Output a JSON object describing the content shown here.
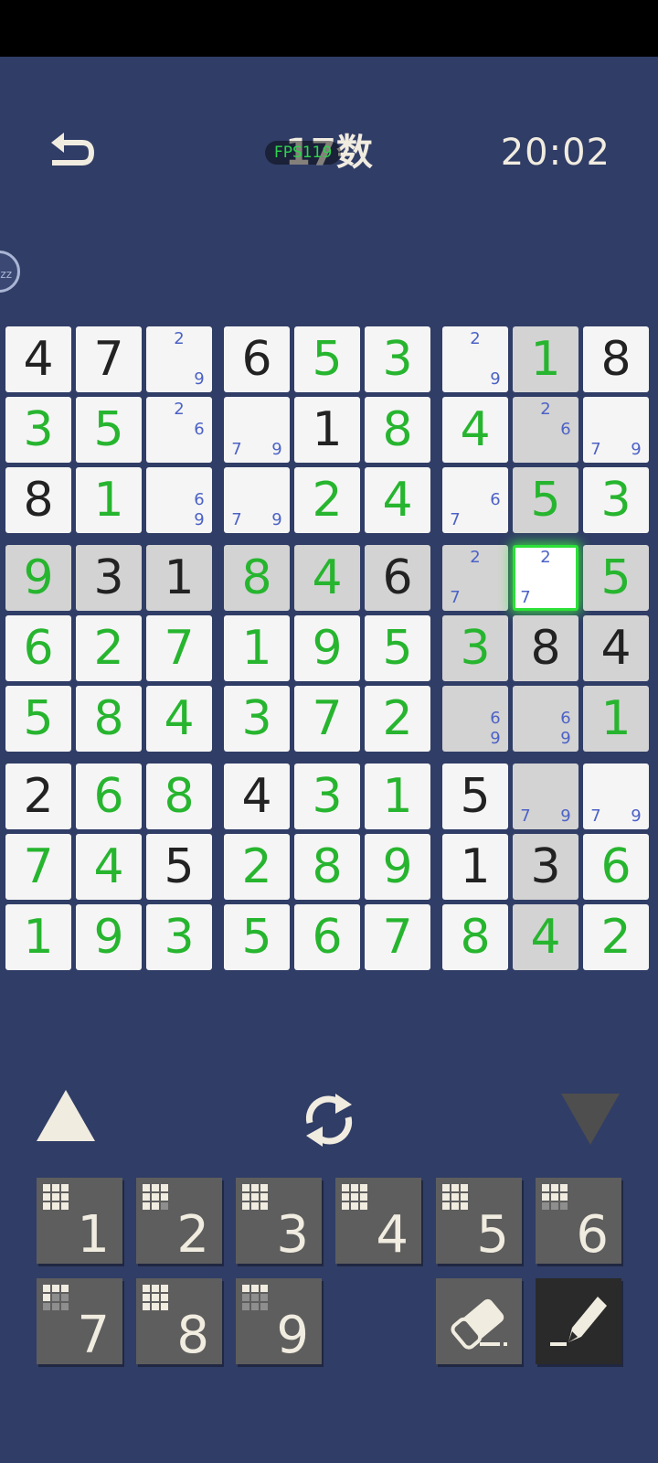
{
  "header": {
    "title": "17数",
    "fps_label": "FPS119",
    "timer": "20:02",
    "side_bubble_label": "zz"
  },
  "colors": {
    "background": "#303d66",
    "cell": "#f5f5f5",
    "highlight": "#d3d3d3",
    "given_digit": "#222222",
    "user_digit": "#27b52f",
    "note_digit": "#4c62c6",
    "selection_glow": "#2be037",
    "key": "#5e5e5e",
    "pencil_key_active": "#2a2a2a"
  },
  "board": {
    "given": [
      [
        1,
        1,
        0,
        1,
        0,
        0,
        0,
        0,
        1
      ],
      [
        0,
        0,
        0,
        0,
        1,
        0,
        0,
        0,
        0
      ],
      [
        1,
        0,
        0,
        0,
        0,
        0,
        0,
        0,
        0
      ],
      [
        0,
        1,
        1,
        0,
        0,
        1,
        0,
        0,
        0
      ],
      [
        0,
        0,
        0,
        0,
        0,
        0,
        0,
        1,
        1
      ],
      [
        0,
        0,
        0,
        0,
        0,
        0,
        0,
        0,
        0
      ],
      [
        1,
        0,
        0,
        1,
        0,
        0,
        1,
        0,
        0
      ],
      [
        0,
        0,
        1,
        0,
        0,
        0,
        1,
        1,
        0
      ],
      [
        0,
        0,
        0,
        0,
        0,
        0,
        0,
        0,
        0
      ]
    ],
    "values": [
      [
        "4",
        "7",
        "",
        "6",
        "5",
        "3",
        "",
        "1",
        "8"
      ],
      [
        "3",
        "5",
        "",
        "",
        "1",
        "8",
        "4",
        "",
        ""
      ],
      [
        "8",
        "1",
        "",
        "",
        "2",
        "4",
        "",
        "5",
        "3"
      ],
      [
        "9",
        "3",
        "1",
        "8",
        "4",
        "6",
        "",
        "",
        "5"
      ],
      [
        "6",
        "2",
        "7",
        "1",
        "9",
        "5",
        "3",
        "8",
        "4"
      ],
      [
        "5",
        "8",
        "4",
        "3",
        "7",
        "2",
        "",
        "",
        "1"
      ],
      [
        "2",
        "6",
        "8",
        "4",
        "3",
        "1",
        "5",
        "",
        ""
      ],
      [
        "7",
        "4",
        "5",
        "2",
        "8",
        "9",
        "1",
        "3",
        "6"
      ],
      [
        "1",
        "9",
        "3",
        "5",
        "6",
        "7",
        "8",
        "4",
        "2"
      ]
    ],
    "notes": [
      [
        [],
        [],
        [
          "2",
          "9"
        ],
        [],
        [],
        [],
        [
          "2",
          "9"
        ],
        [],
        []
      ],
      [
        [],
        [],
        [
          "2",
          "6"
        ],
        [
          "7",
          "9"
        ],
        [],
        [],
        [],
        [
          "2",
          "6"
        ],
        [
          "7",
          "9"
        ]
      ],
      [
        [],
        [],
        [
          "6",
          "9"
        ],
        [
          "7",
          "9"
        ],
        [],
        [],
        [
          "6",
          "7"
        ],
        [],
        []
      ],
      [
        [],
        [],
        [],
        [],
        [],
        [],
        [
          "2",
          "7"
        ],
        [
          "2",
          "7"
        ],
        []
      ],
      [
        [],
        [],
        [],
        [],
        [],
        [],
        [],
        [],
        []
      ],
      [
        [],
        [],
        [],
        [],
        [],
        [],
        [
          "6",
          "9"
        ],
        [
          "6",
          "9"
        ],
        []
      ],
      [
        [],
        [],
        [],
        [],
        [],
        [],
        [],
        [
          "7",
          "9"
        ],
        [
          "7",
          "9"
        ]
      ],
      [
        [],
        [],
        [],
        [],
        [],
        [],
        [],
        [],
        []
      ],
      [
        [],
        [],
        [],
        [],
        [],
        [],
        [],
        [],
        []
      ]
    ],
    "highlighted": [
      [
        0,
        0,
        0,
        0,
        0,
        0,
        0,
        1,
        0
      ],
      [
        0,
        0,
        0,
        0,
        0,
        0,
        0,
        1,
        0
      ],
      [
        0,
        0,
        0,
        0,
        0,
        0,
        0,
        1,
        0
      ],
      [
        1,
        1,
        1,
        1,
        1,
        1,
        1,
        0,
        1
      ],
      [
        0,
        0,
        0,
        0,
        0,
        0,
        1,
        1,
        1
      ],
      [
        0,
        0,
        0,
        0,
        0,
        0,
        1,
        1,
        1
      ],
      [
        0,
        0,
        0,
        0,
        0,
        0,
        0,
        1,
        0
      ],
      [
        0,
        0,
        0,
        0,
        0,
        0,
        0,
        1,
        0
      ],
      [
        0,
        0,
        0,
        0,
        0,
        0,
        0,
        1,
        0
      ]
    ],
    "selected": [
      3,
      7
    ]
  },
  "controls": {
    "prev_icon": "triangle-up-icon",
    "refresh_icon": "refresh-icon",
    "next_icon": "triangle-down-icon",
    "number_keys": [
      {
        "label": "1",
        "remaining_cells": 0
      },
      {
        "label": "2",
        "remaining_cells": 1
      },
      {
        "label": "3",
        "remaining_cells": 0
      },
      {
        "label": "4",
        "remaining_cells": 0
      },
      {
        "label": "5",
        "remaining_cells": 0
      },
      {
        "label": "6",
        "remaining_cells": 3
      },
      {
        "label": "7",
        "remaining_cells": 5
      },
      {
        "label": "8",
        "remaining_cells": 0
      },
      {
        "label": "9",
        "remaining_cells": 6
      }
    ],
    "eraser_icon": "eraser-icon",
    "pencil_icon": "pencil-icon",
    "pencil_mode": "on"
  }
}
